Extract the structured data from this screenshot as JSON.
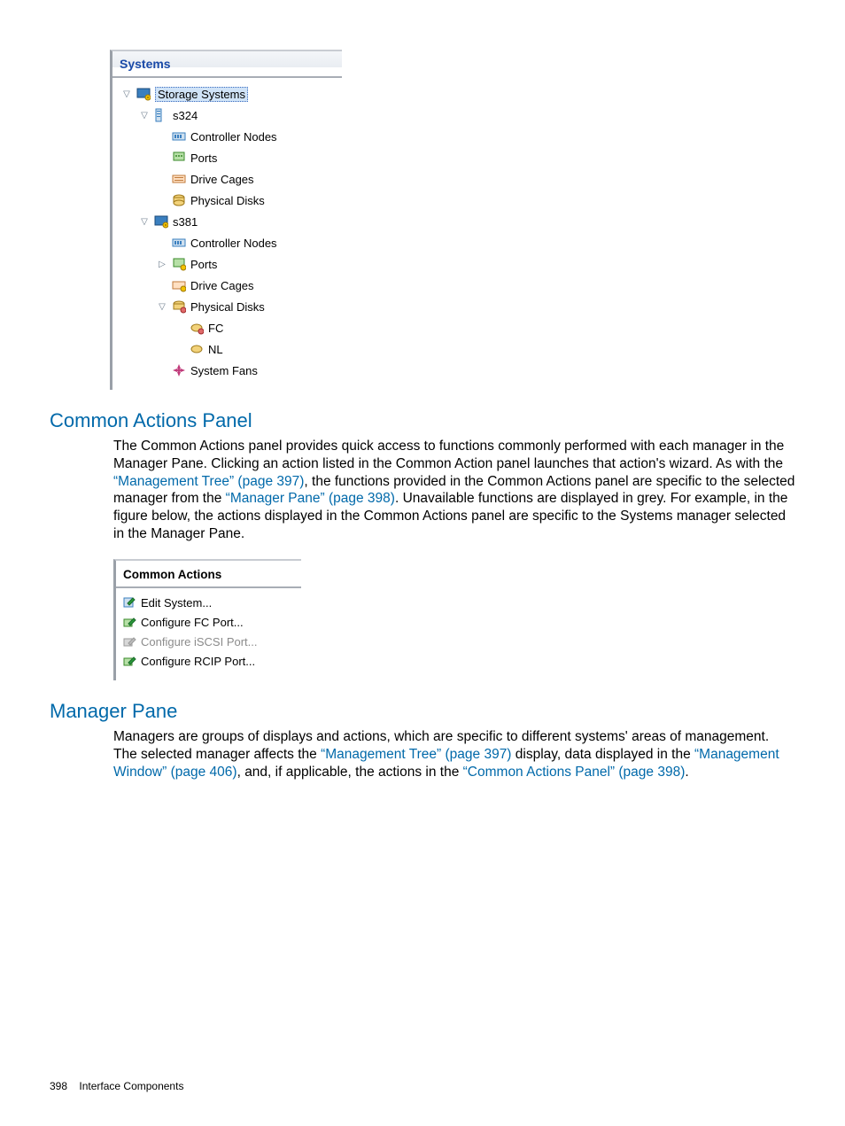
{
  "tree": {
    "title": "Systems",
    "root": "Storage Systems",
    "nodes": {
      "s324": {
        "label": "s324",
        "children": [
          "Controller Nodes",
          "Ports",
          "Drive Cages",
          "Physical Disks"
        ]
      },
      "s381": {
        "label": "s381",
        "children": [
          "Controller Nodes",
          "Ports",
          "Drive Cages",
          "Physical Disks",
          "FC",
          "NL",
          "System Fans"
        ]
      }
    }
  },
  "sections": {
    "common_actions": {
      "heading": "Common Actions Panel",
      "body_parts": {
        "p1": "The Common Actions panel provides quick access to functions commonly performed with each manager in the Manager Pane. Clicking an action listed in the Common Action panel launches that action's wizard. As with the ",
        "link1": "“Management Tree” (page 397)",
        "p2": ", the functions provided in the Common Actions panel are specific to the selected manager from the ",
        "link2": "“Manager Pane” (page 398)",
        "p3": ". Unavailable functions are displayed in grey. For example, in the figure below, the actions displayed in the Common Actions panel are specific to the Systems manager selected in the Manager Pane."
      }
    },
    "manager_pane": {
      "heading": "Manager Pane",
      "body_parts": {
        "p1": "Managers are groups of displays and actions, which are specific to different systems' areas of management. The selected manager affects the ",
        "link1": "“Management Tree” (page 397)",
        "p2": " display, data displayed in the ",
        "link2": "“Management Window” (page 406)",
        "p3": ", and, if applicable, the actions in the ",
        "link3": "“Common Actions Panel” (page 398)",
        "p4": "."
      }
    }
  },
  "actions_panel": {
    "title": "Common Actions",
    "items": [
      {
        "label": "Edit System...",
        "enabled": true
      },
      {
        "label": "Configure FC Port...",
        "enabled": true
      },
      {
        "label": "Configure iSCSI Port...",
        "enabled": false
      },
      {
        "label": "Configure RCIP Port...",
        "enabled": true
      }
    ]
  },
  "footer": {
    "page": "398",
    "section": "Interface Components"
  }
}
